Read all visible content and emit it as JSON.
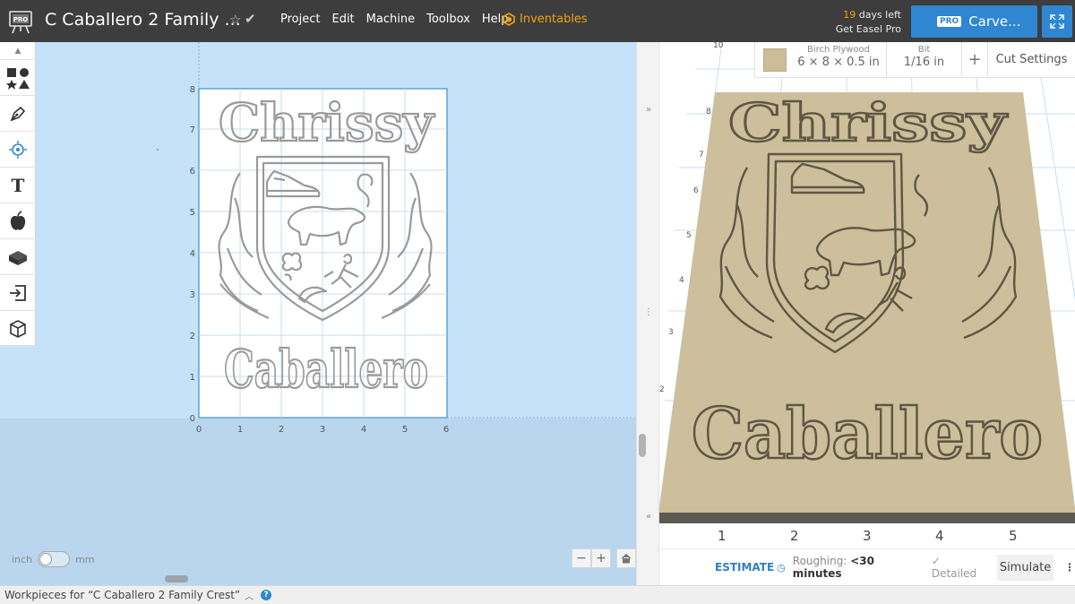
{
  "header": {
    "doc_title": "C Caballero 2 Family ...",
    "menu": [
      "Project",
      "Edit",
      "Machine",
      "Toolbox",
      "Help"
    ],
    "inventables": "Inventables",
    "trial_days": "19",
    "trial_days_suffix": " days left",
    "trial_cta": "Get Easel Pro",
    "pro_badge": "PRO",
    "carve_label": "Carve...",
    "logo_text": "PRO"
  },
  "design": {
    "y_ticks": [
      "0",
      "1",
      "2",
      "3",
      "4",
      "5",
      "6",
      "7",
      "8"
    ],
    "x_ticks": [
      "0",
      "1",
      "2",
      "3",
      "4",
      "5",
      "6"
    ],
    "text_top": "Chrissy",
    "text_bottom": "Caballero",
    "unit_left": "inch",
    "unit_right": "mm",
    "zoom_out": "−",
    "zoom_in": "+"
  },
  "preview": {
    "material_name": "Birch Plywood",
    "material_size": "6 × 8 × 0.5 in",
    "bit_label": "Bit",
    "bit_size": "1/16 in",
    "add": "+",
    "cut_settings": "Cut Settings",
    "top_axis_tick": "10",
    "side_ticks": [
      "8",
      "7",
      "6",
      "5",
      "4",
      "3",
      "2"
    ],
    "x_ticks": [
      "1",
      "2",
      "3",
      "4",
      "5"
    ],
    "text_top": "Chrissy",
    "text_bottom": "Caballero",
    "estimate": "ESTIMATE",
    "roughing_label": "Roughing:",
    "roughing_value": "<30 minutes",
    "detailed": "Detailed",
    "simulate": "Simulate",
    "more": "⋮"
  },
  "status": {
    "workpieces": "Workpieces for “C Caballero 2 Family Crest”",
    "help": "?"
  },
  "colors": {
    "topbar": "#3d3d3d",
    "accent_blue": "#2f86d1",
    "accent_orange": "#f0a30a",
    "canvas_bg": "#c6e2f8",
    "wood": "#cdbf9b"
  }
}
